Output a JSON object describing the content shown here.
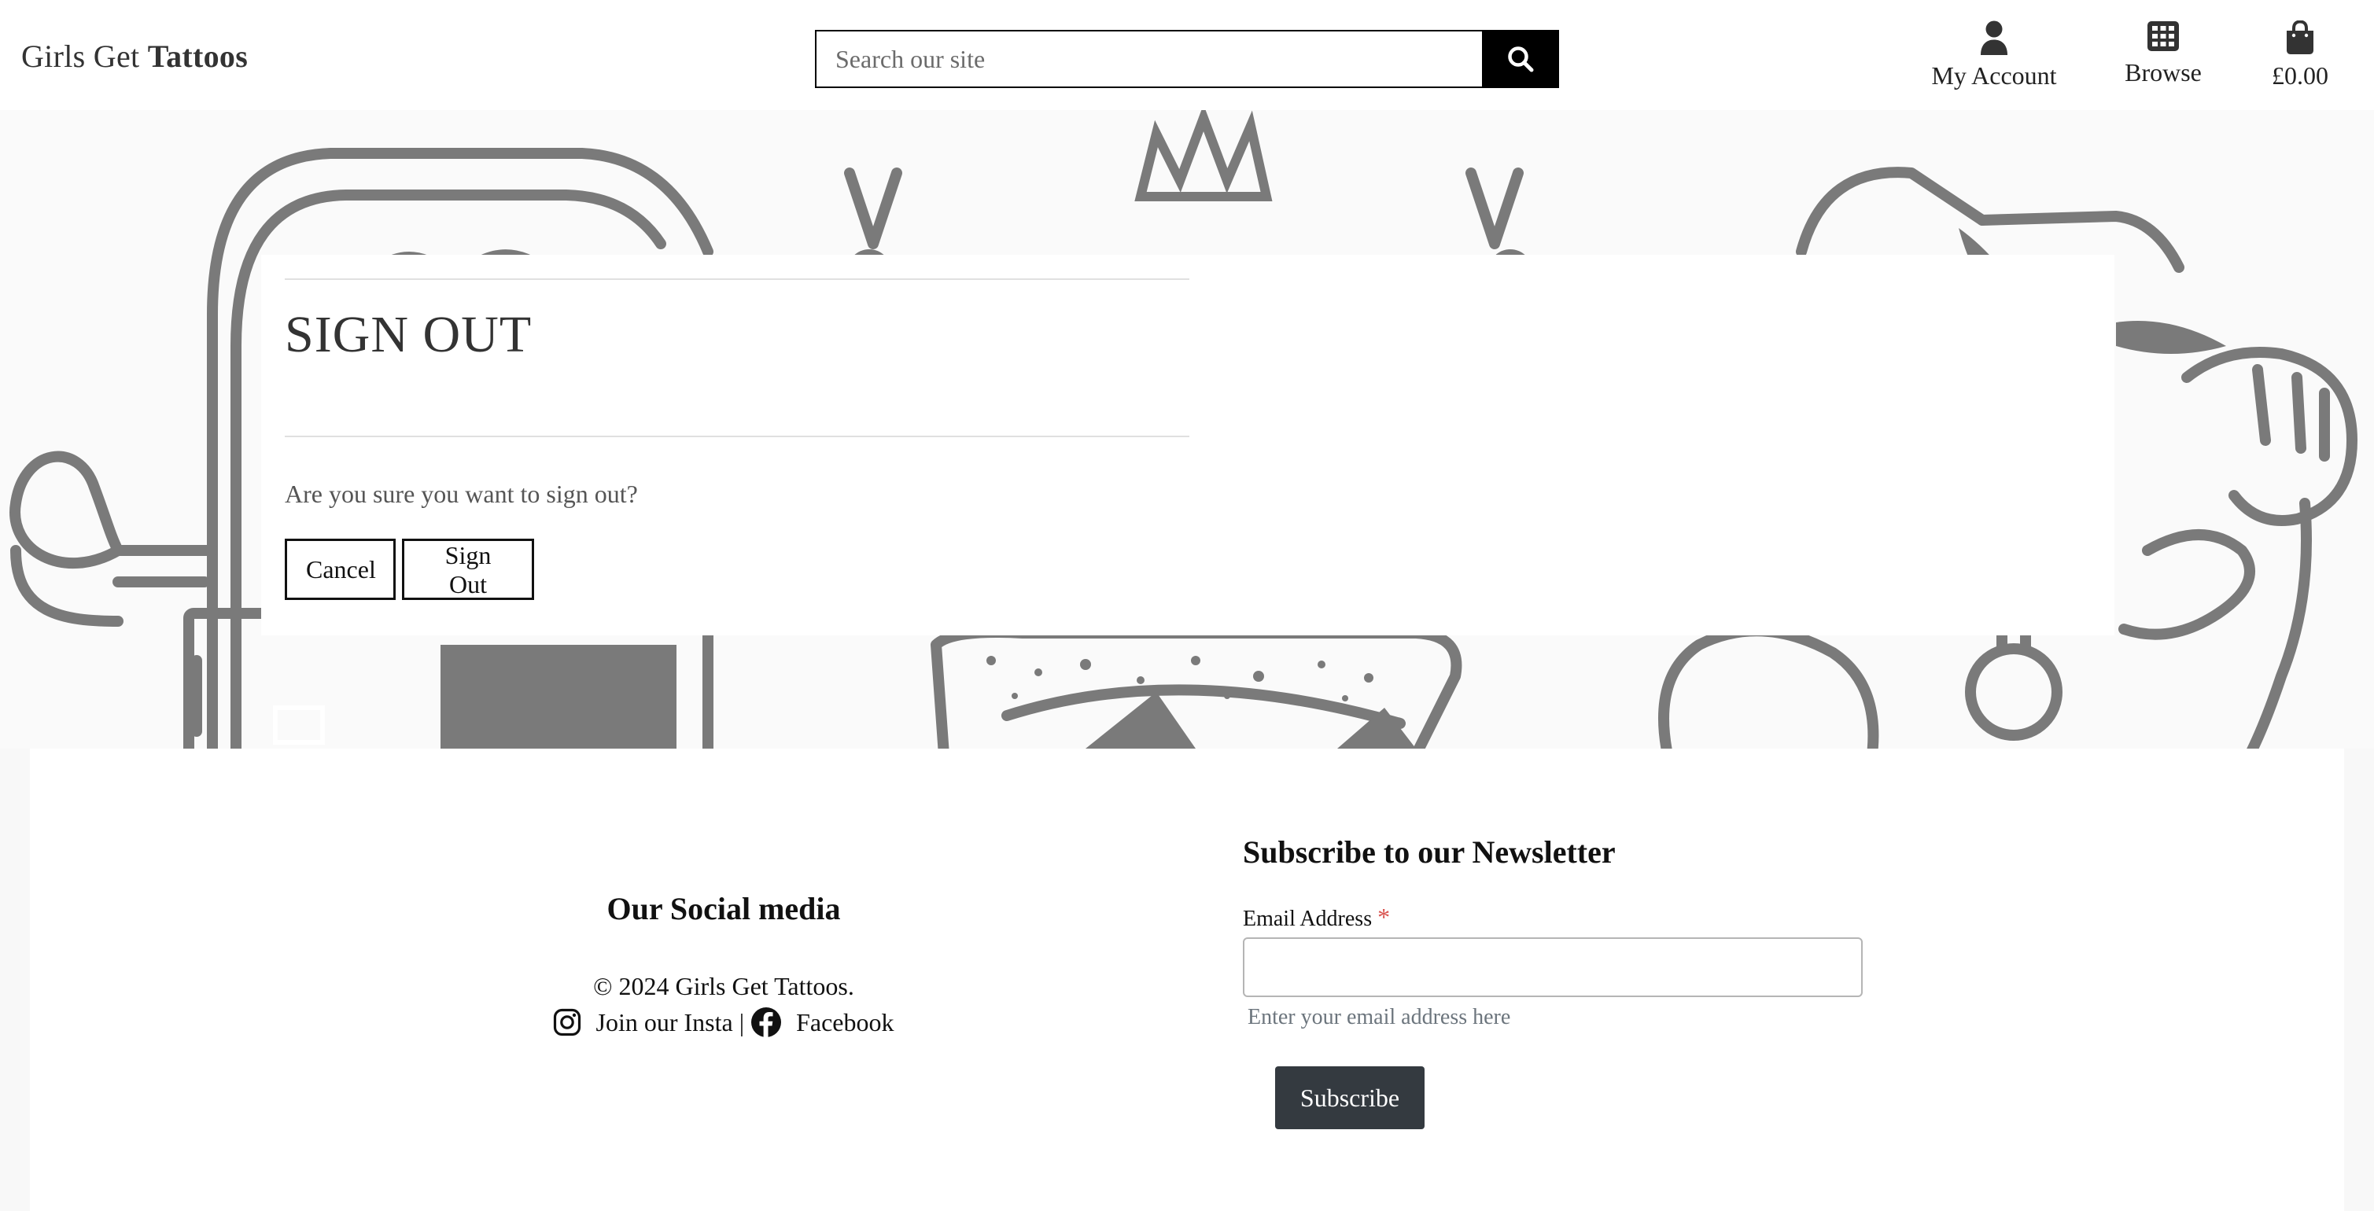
{
  "header": {
    "brand_light": "Girls Get",
    "brand_bold": "Tattoos",
    "search_placeholder": "Search our site",
    "account_label": "My Account",
    "browse_label": "Browse",
    "bag_total": "£0.00"
  },
  "signout": {
    "title": "SIGN OUT",
    "message": "Are you sure you want to sign out?",
    "cancel_label": "Cancel",
    "signout_label": "Sign Out"
  },
  "footer": {
    "social_title": "Our Social media",
    "copyright": "© 2024 Girls Get Tattoos.",
    "insta_label": "Join our Insta",
    "separator": "|",
    "facebook_label": "Facebook",
    "newsletter_title": "Subscribe to our Newsletter",
    "email_label": "Email Address",
    "required_mark": "*",
    "email_help": "Enter your email address here",
    "subscribe_label": "Subscribe"
  },
  "colors": {
    "header_bg": "#ffffff",
    "search_button": "#000000",
    "subscribe_button": "#343a40",
    "required": "#d9534f",
    "hero_art": "#7a7a7a"
  },
  "icons": [
    "search-icon",
    "user-icon",
    "grid-icon",
    "shopping-bag-icon",
    "instagram-icon",
    "facebook-icon"
  ]
}
